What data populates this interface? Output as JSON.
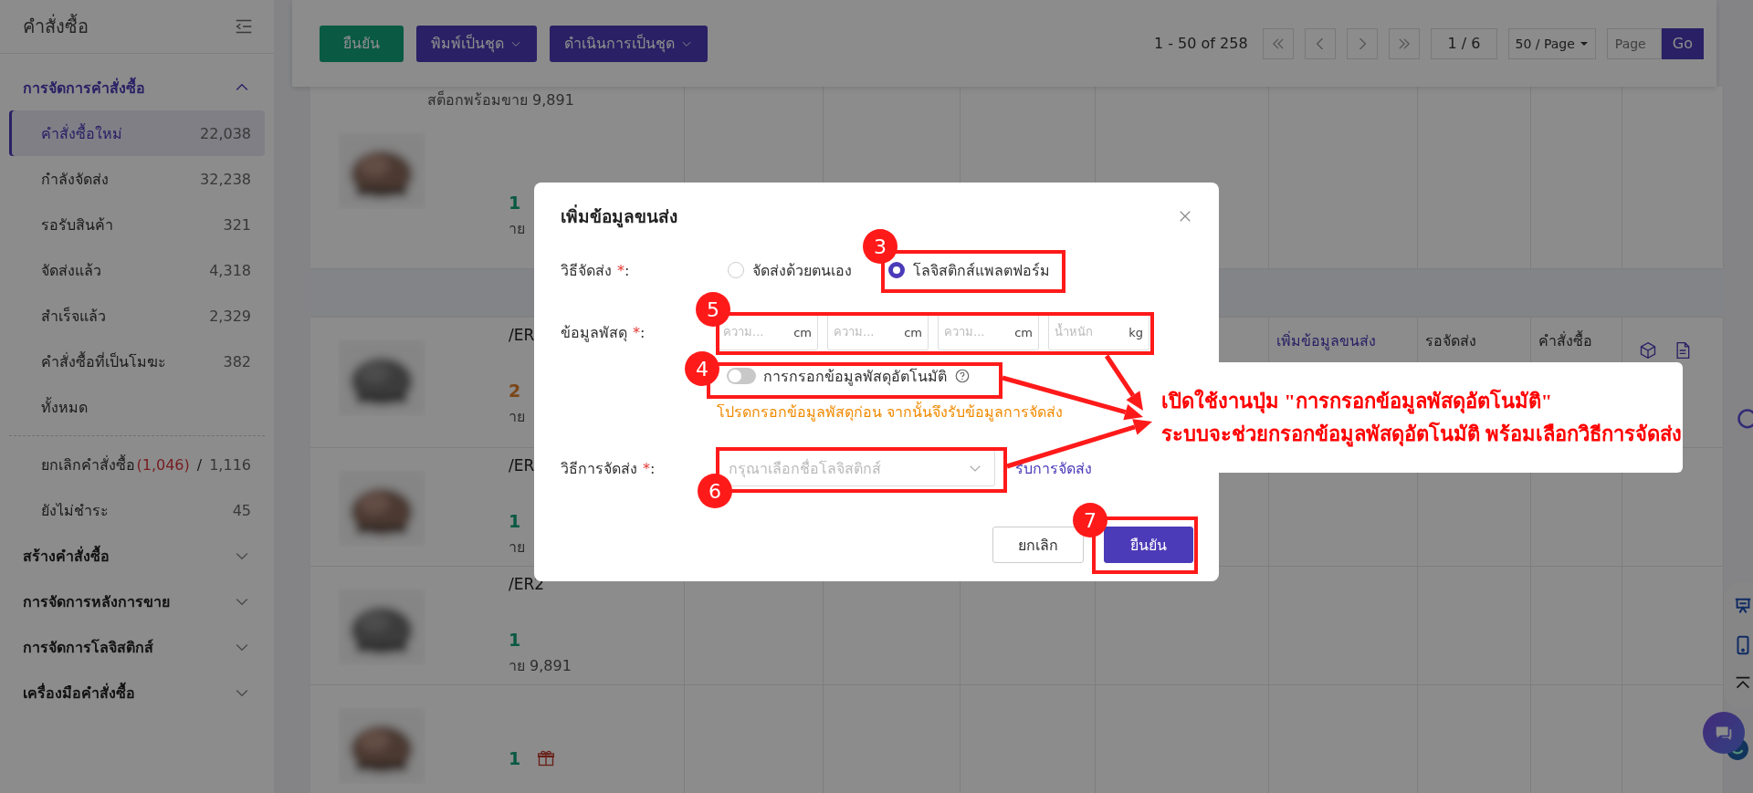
{
  "sidebar": {
    "title": "คำสั่งซื้อ",
    "groups": [
      {
        "label": "การจัดการคำสั่งซื้อ",
        "expanded": true,
        "items": [
          {
            "label": "คำสั่งซื้อใหม่",
            "count": "22,038",
            "selected": true
          },
          {
            "label": "กำลังจัดส่ง",
            "count": "32,238",
            "selected": false
          },
          {
            "label": "รอรับสินค้า",
            "count": "321",
            "selected": false
          },
          {
            "label": "จัดส่งแล้ว",
            "count": "4,318",
            "selected": false
          },
          {
            "label": "สำเร็จแล้ว",
            "count": "2,329",
            "selected": false
          },
          {
            "label": "คำสั่งซื้อที่เป็นโมฆะ",
            "count": "382",
            "selected": false
          },
          {
            "label": "ทั้งหมด",
            "selected": false
          }
        ],
        "more_items": [
          {
            "label": "ยกเลิกคำสั่งซื้อ",
            "alert_count": "(1,046)",
            "separator": "/",
            "count": "1,116",
            "selected": false
          },
          {
            "label": "ยังไม่ชำระ",
            "count": "45",
            "selected": false
          }
        ]
      },
      {
        "label": "สร้างคำสั่งซื้อ",
        "expanded": false
      },
      {
        "label": "การจัดการหลังการขาย",
        "expanded": false
      },
      {
        "label": "การจัดการโลจิสติกส์",
        "expanded": false
      },
      {
        "label": "เครื่องมือคำสั่งซื้อ",
        "expanded": false
      }
    ]
  },
  "toolbar": {
    "actions": [
      {
        "label": "ยืนยัน",
        "kind": "primary"
      },
      {
        "label": "พิมพ์เป็นชุด",
        "kind": "dropdown"
      },
      {
        "label": "ดำเนินการเป็นชุด",
        "kind": "dropdown"
      }
    ],
    "pagination": {
      "range": "1 - 50 of 258",
      "page": "1 / 6",
      "page_size": "50 / Page",
      "jump_placeholder": "Page",
      "go": "Go"
    }
  },
  "table": {
    "stock_note": "สต็อกพร้อมขาย 9,891",
    "rows": [
      {
        "qty": "1",
        "highlighted": false,
        "stock": "าย"
      },
      {
        "sku": "/ER",
        "qty": "2",
        "highlighted": true,
        "stock": "าย",
        "shipping_action": "เพิ่มข้อมูลขนส่ง",
        "status": "รอจัดส่ง",
        "order_type": "คำสั่งซื้อ"
      },
      {
        "sku": "/ER",
        "qty": "1",
        "highlighted": false,
        "stock": "าย"
      },
      {
        "sku": "/ER2",
        "qty": "1",
        "highlighted": false,
        "stock": "าย 9,891"
      },
      {
        "qty": "1",
        "highlighted": false,
        "gift": true
      }
    ]
  },
  "dialog": {
    "title": "เพิ่มข้อมูลขนส่ง",
    "method": {
      "label": "วิธีจัดส่ง",
      "required": "*",
      "colon": ":",
      "options": [
        {
          "label": "จัดส่งด้วยตนเอง",
          "selected": false
        },
        {
          "label": "โลจิสติกส์แพลตฟอร์ม",
          "selected": true
        }
      ]
    },
    "parcel": {
      "label": "ข้อมูลพัสดุ",
      "required": "*",
      "colon": ":",
      "fields": [
        {
          "placeholder": "ความ...",
          "unit": "cm"
        },
        {
          "placeholder": "ความ...",
          "unit": "cm"
        },
        {
          "placeholder": "ความ...",
          "unit": "cm"
        },
        {
          "placeholder": "น้ำหนัก",
          "unit": "kg"
        }
      ]
    },
    "auto_fill": {
      "label": "การกรอกข้อมูลพัสดุอัตโนมัติ",
      "on": false
    },
    "hint": "โปรดกรอกข้อมูลพัสดุก่อน จากนั้นจึงรับข้อมูลการจัดส่ง",
    "shipping": {
      "label": "วิธีการจัดส่ง",
      "required": "*",
      "colon": ":",
      "placeholder": "กรุณาเลือกชื่อโลจิสติกส์",
      "link": "รับการจัดส่ง"
    },
    "cancel": "ยกเลิก",
    "confirm": "ยืนยัน"
  },
  "guide": {
    "markers": [
      {
        "number": "3"
      },
      {
        "number": "5"
      },
      {
        "number": "4"
      },
      {
        "number": "6"
      },
      {
        "number": "7"
      }
    ],
    "callout": [
      "เปิดใช้งานปุ่ม \"การกรอกข้อมูลพัสดุอัตโนมัติ\"",
      "ระบบจะช่วยกรอกข้อมูลพัสดุอัตโนมัติ พร้อมเลือกวิธีการจัดส่ง"
    ]
  }
}
